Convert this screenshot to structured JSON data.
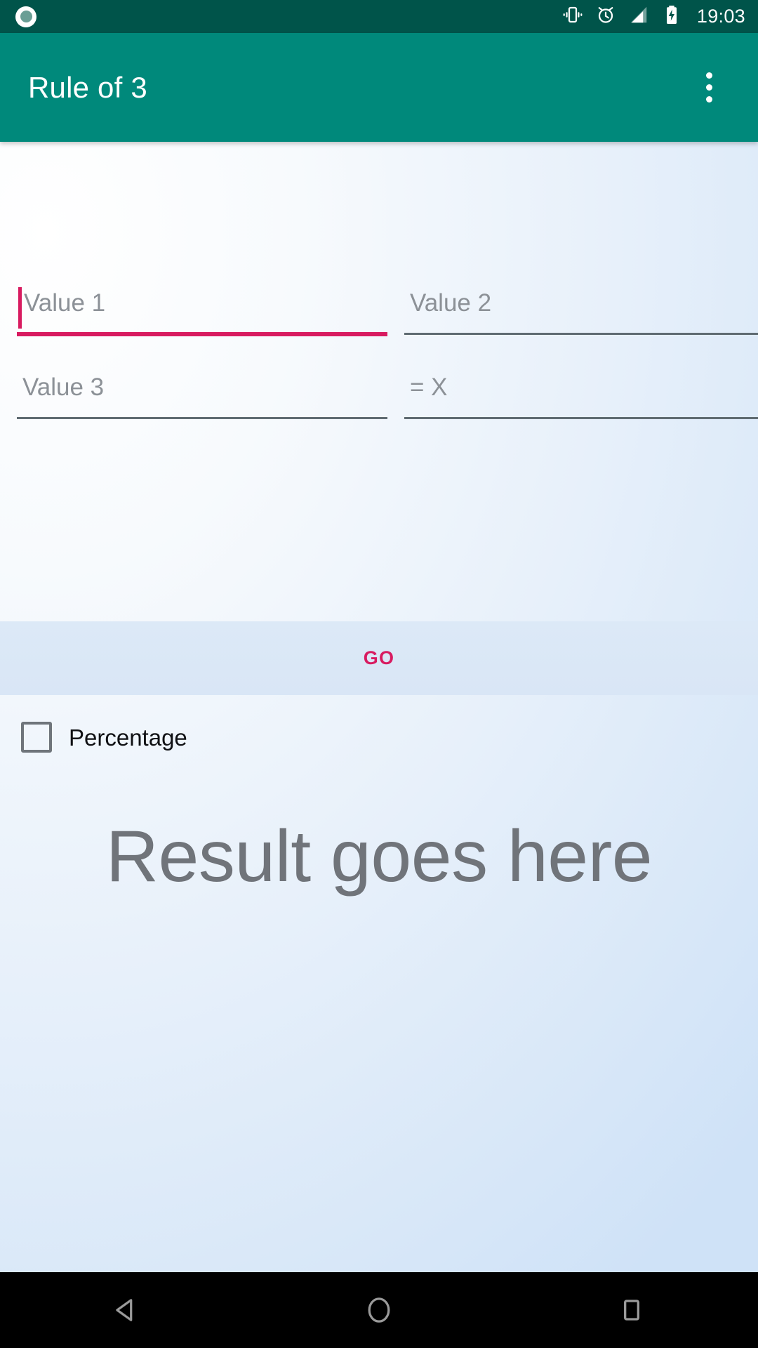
{
  "statusbar": {
    "app_icon": "app-circle-icon",
    "icons": [
      "vibrate-icon",
      "alarm-clock-icon",
      "signal-bars-icon",
      "battery-charging-icon"
    ],
    "time": "19:03"
  },
  "appbar": {
    "title": "Rule of 3",
    "overflow_icon": "overflow-menu-icon"
  },
  "form": {
    "fields": [
      {
        "name": "value-1",
        "placeholder": "Value 1",
        "value": "",
        "focused": true
      },
      {
        "name": "value-2",
        "placeholder": "Value 2",
        "value": "",
        "focused": false
      },
      {
        "name": "value-3",
        "placeholder": "Value 3",
        "value": "",
        "focused": false
      },
      {
        "name": "result-x",
        "placeholder": "= X",
        "value": "",
        "focused": false
      }
    ],
    "go_label": "GO",
    "percentage_label": "Percentage",
    "percentage_checked": false
  },
  "result": {
    "text": "Result goes here"
  },
  "navbar": {
    "back": "back-triangle-icon",
    "home": "home-circle-icon",
    "recents": "recents-square-icon"
  },
  "colors": {
    "status_bar": "#00544A",
    "app_bar": "#00897B",
    "accent": "#D81B60",
    "placeholder": "#8C9197",
    "result_text": "#70747A",
    "go_bar_bg": "#DCE9F7"
  }
}
